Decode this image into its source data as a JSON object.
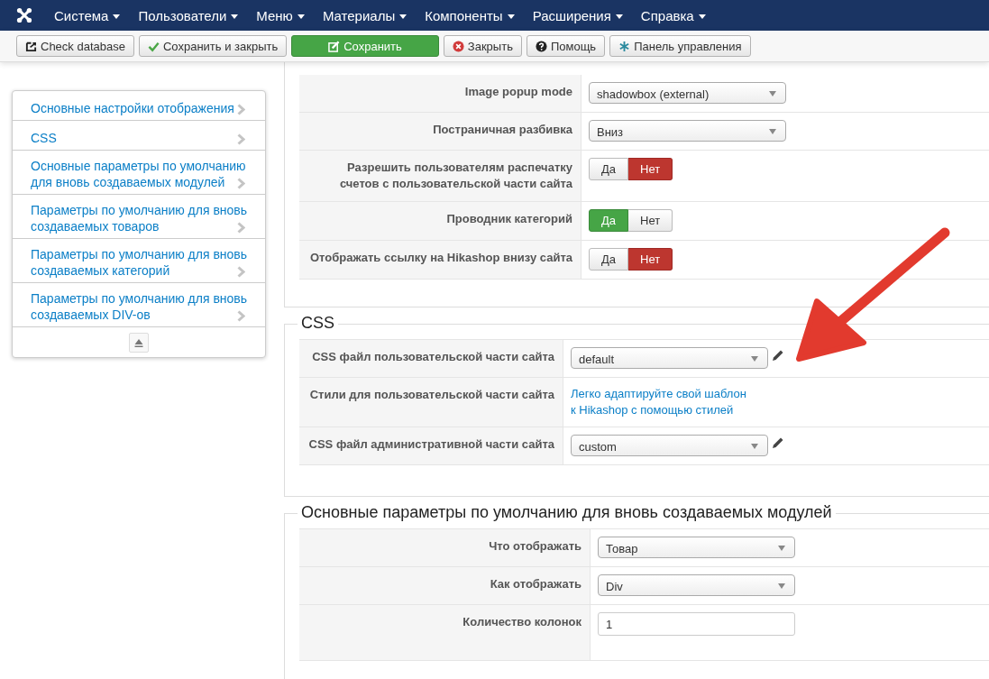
{
  "navbar": {
    "menus": [
      "Система",
      "Пользователи",
      "Меню",
      "Материалы",
      "Компоненты",
      "Расширения",
      "Справка"
    ]
  },
  "toolbar": {
    "buttons": [
      {
        "label": "Check database",
        "kind": "database"
      },
      {
        "label": "Сохранить и закрыть",
        "kind": "check"
      },
      {
        "label": "Сохранить",
        "kind": "edit"
      },
      {
        "label": "Закрыть",
        "kind": "close"
      },
      {
        "label": "Помощь",
        "kind": "help"
      },
      {
        "label": "Панель управления",
        "kind": "dashboard"
      }
    ]
  },
  "sidebar": {
    "items": [
      "Основные настройки отображения",
      "CSS",
      "Основные параметры по умолчанию для вновь создаваемых модулей",
      "Параметры по умолчанию для вновь создаваемых товаров",
      "Параметры по умолчанию для вновь создаваемых категорий",
      "Параметры по умолчанию для вновь создаваемых DIV-ов"
    ]
  },
  "sections": [
    {
      "rows": [
        {
          "kind": "select",
          "label": "Image popup mode",
          "value": "shadowbox (external)",
          "editable": false
        },
        {
          "kind": "select",
          "label": "Постраничная разбивка",
          "value": "Вниз",
          "editable": false
        },
        {
          "kind": "toggle",
          "label": "Разрешить пользователям распечатку счетов с пользовательской части сайта",
          "options": [
            {
              "label": "Да",
              "selected": false
            },
            {
              "label": "Нет",
              "selected": true
            }
          ]
        },
        {
          "kind": "toggle",
          "label": "Проводник категорий",
          "options": [
            {
              "label": "Да",
              "selected": true
            },
            {
              "label": "Нет",
              "selected": false
            }
          ]
        },
        {
          "kind": "toggle",
          "label": "Отображать ссылку на Hikashop внизу сайта",
          "options": [
            {
              "label": "Да",
              "selected": false
            },
            {
              "label": "Нет",
              "selected": true
            }
          ]
        }
      ]
    },
    {
      "legend": "CSS",
      "rows": [
        {
          "kind": "select",
          "label": "CSS файл пользовательской части сайта",
          "value": "default",
          "editable": true
        },
        {
          "kind": "link",
          "label": "Стили для пользовательской части сайта",
          "lines": [
            "Легко адаптируйте свой шаблон",
            "к Hikashop с помощью стилей"
          ]
        },
        {
          "kind": "select",
          "label": "CSS файл административной части сайта",
          "value": "custom",
          "editable": true
        }
      ]
    },
    {
      "legend": "Основные параметры по умолчанию для вновь создаваемых модулей",
      "rows": [
        {
          "kind": "select",
          "label": "Что отображать",
          "value": "Товар",
          "editable": false
        },
        {
          "kind": "select",
          "label": "Как отображать",
          "value": "Div",
          "editable": false
        },
        {
          "kind": "text",
          "label": "Количество колонок",
          "value": "1"
        }
      ]
    }
  ]
}
